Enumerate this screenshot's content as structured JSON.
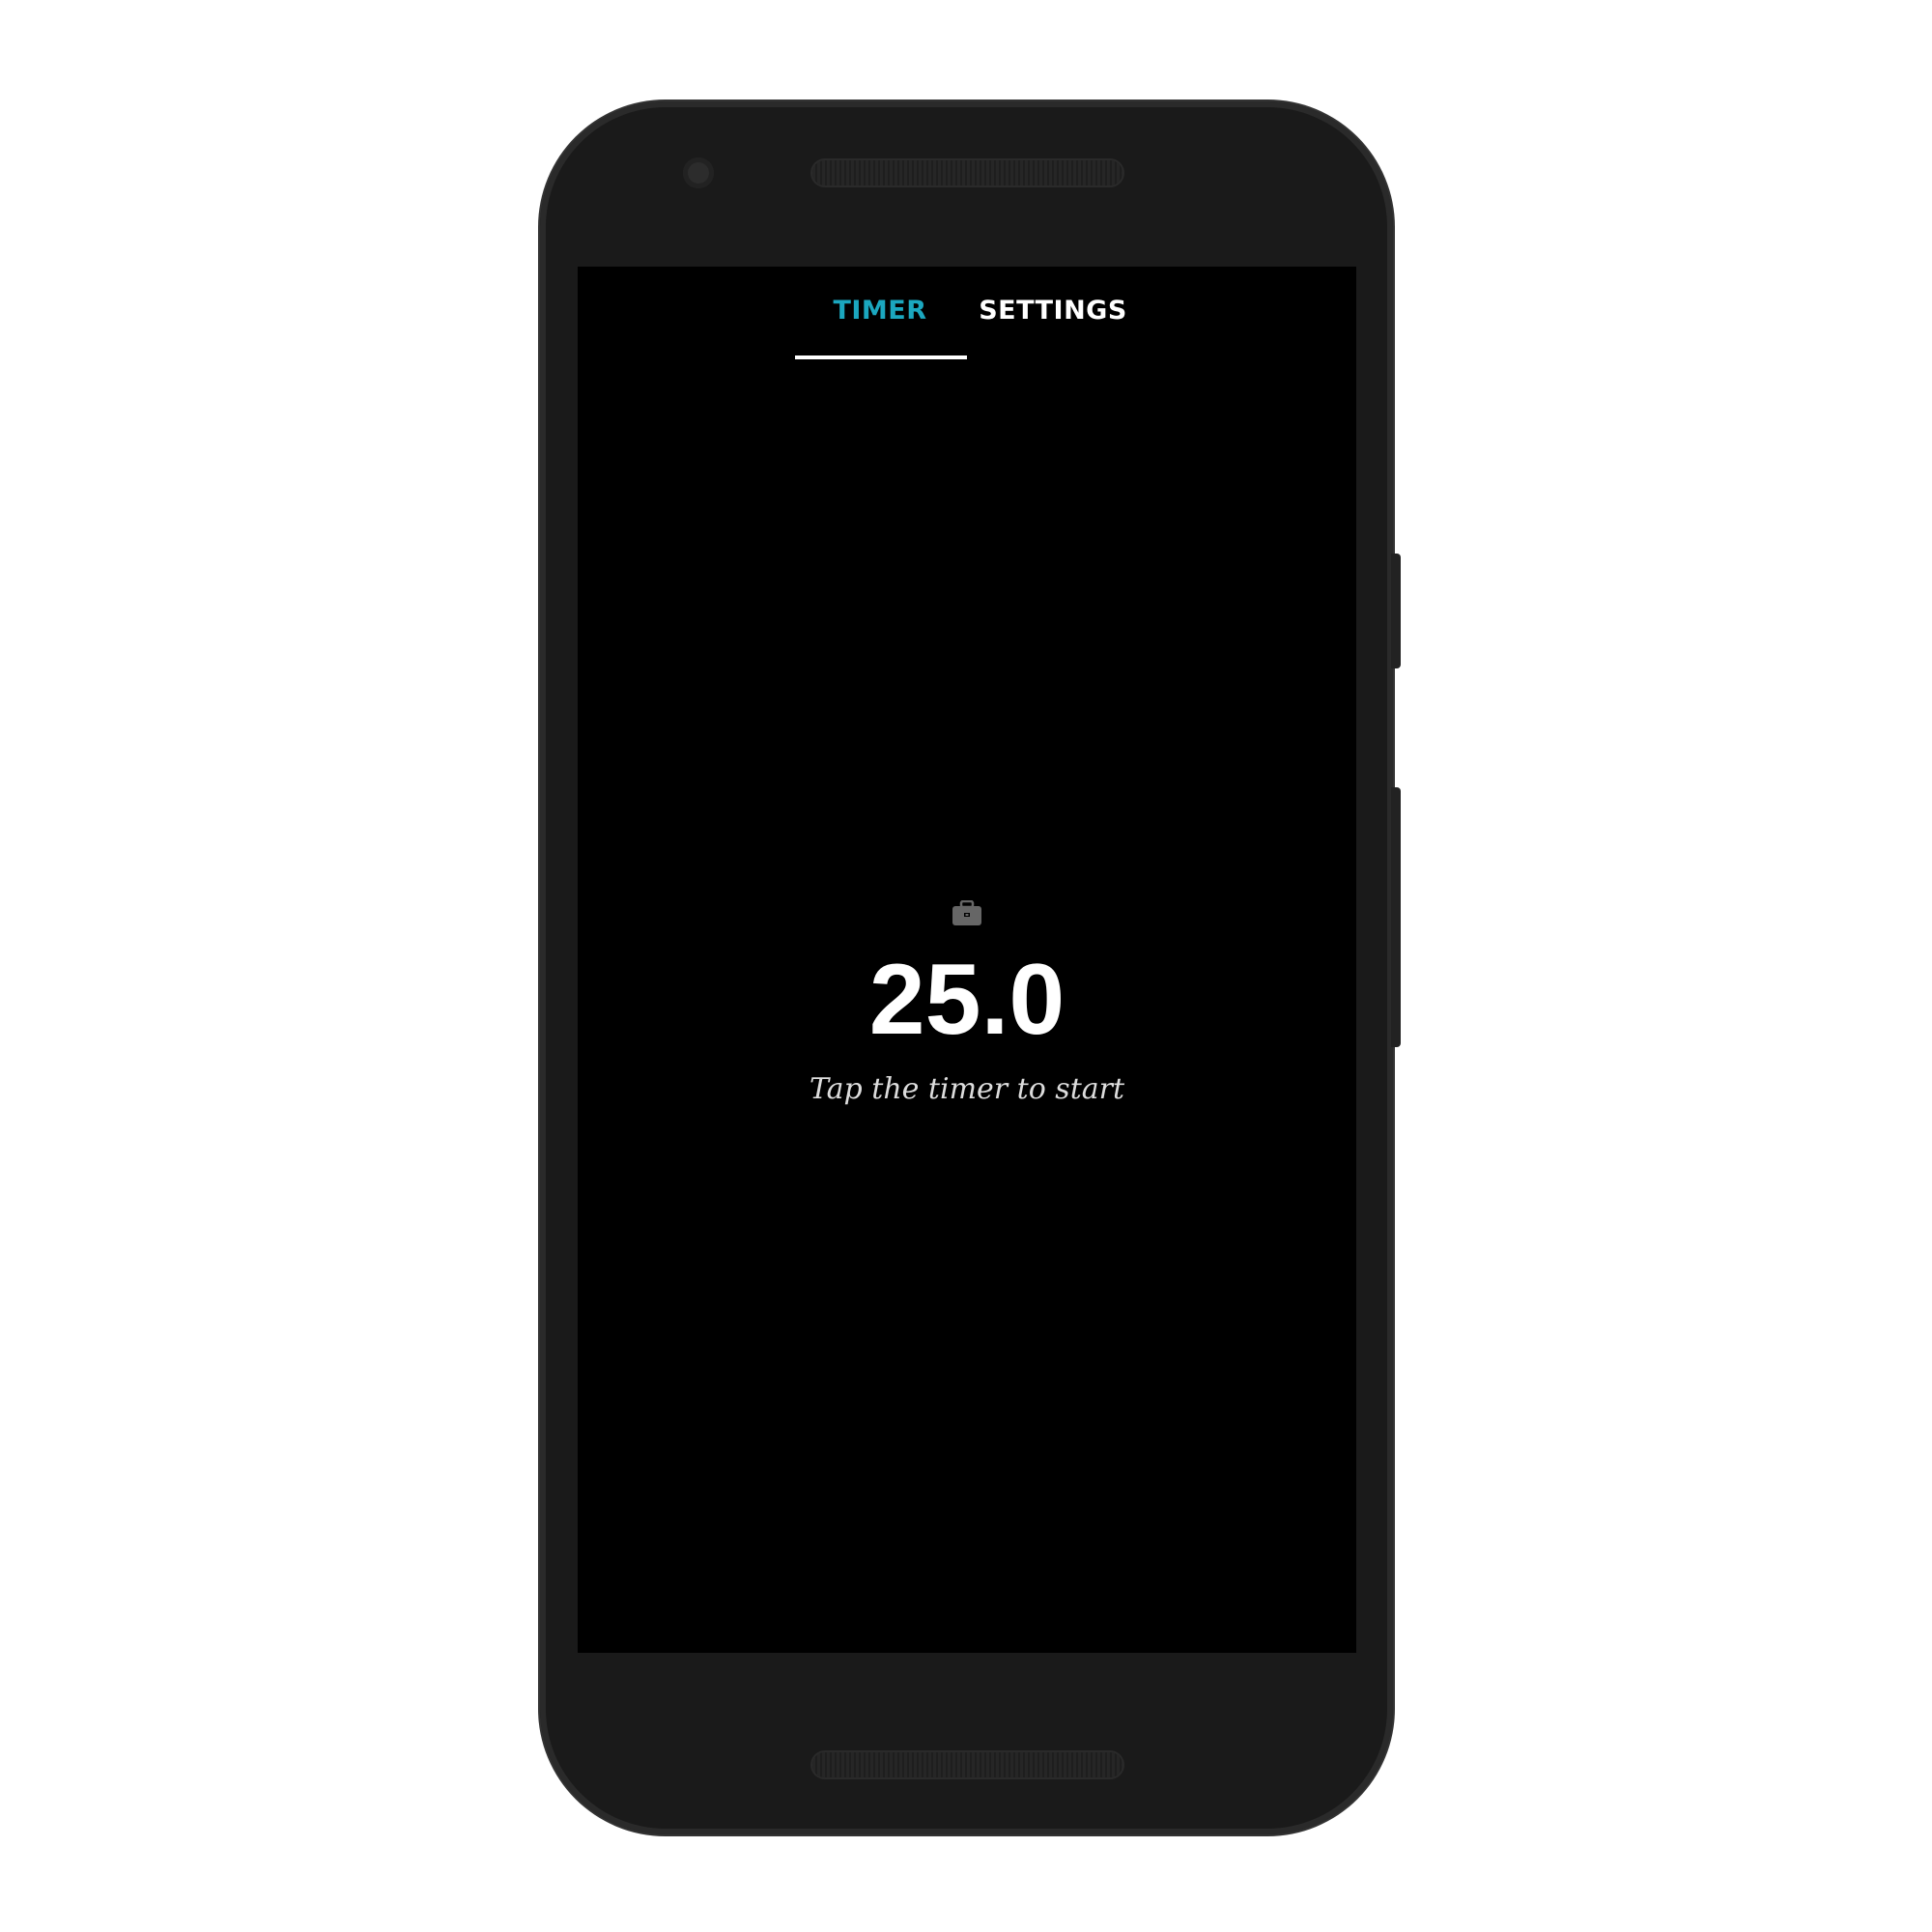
{
  "tabs": [
    {
      "label": "TIMER",
      "active": true,
      "color": "#1ba7bf"
    },
    {
      "label": "SETTINGS",
      "active": false,
      "color": "#ffffff"
    }
  ],
  "timer": {
    "icon": "briefcase-icon",
    "value": "25.0",
    "hint": "Tap the timer to start"
  }
}
